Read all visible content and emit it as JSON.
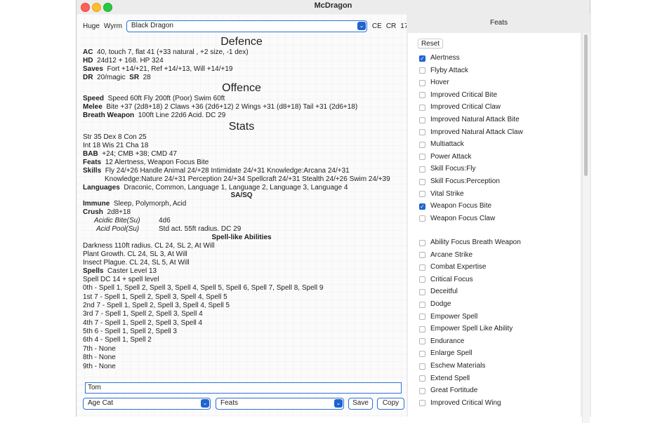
{
  "window": {
    "title": "McDragon"
  },
  "header": {
    "size": "Huge",
    "age": "Wyrm",
    "creature": "Black Dragon",
    "alignment": "CE",
    "cr_label": "CR",
    "cr_value": "17"
  },
  "defence": {
    "heading": "Defence",
    "ac_label": "AC",
    "ac": "40, touch 7, flat 41 (+33 natural , +2 size, -1 dex)",
    "hd_label": "HD",
    "hd": "24d12 + 168. HP 324",
    "saves_label": "Saves",
    "saves": "Fort +14/+21, Ref +14/+13, Will +14/+19",
    "dr_label": "DR",
    "dr": "20/magic",
    "sr_label": "SR",
    "sr": "28"
  },
  "offence": {
    "heading": "Offence",
    "speed_label": "Speed",
    "speed": "Speed 60ft Fly 200ft (Poor) Swim 60ft",
    "melee_label": "Melee",
    "melee": "Bite +37 (2d8+18) 2 Claws +36 (2d6+12) 2 Wings +31 (d8+18) Tail +31 (2d6+18)",
    "breath_label": "Breath Weapon",
    "breath": "100ft Line 22d6 Acid. DC 29"
  },
  "stats": {
    "heading": "Stats",
    "line1": "Str  35  Dex  8  Con  25",
    "line2": "Int  18  Wis  21  Cha  18",
    "bab_label": "BAB",
    "bab": "+24; CMB +38; CMD 47",
    "feats_label": "Feats",
    "feats": "12  Alertness, Weapon Focus Bite",
    "skills_label": "Skills",
    "skills1": "Fly 24/+26 Handle Animal 24/+28 Intimidate 24/+31 Knowledge:Arcana 24/+31",
    "skills2": "Knowledge:Nature 24/+31 Perception 24/+34 Spellcraft 24/+31 Stealth 24/+26 Swim 24/+39",
    "languages_label": "Languages",
    "languages": "Draconic, Common, Language 1, Language 2, Language 3, Language 4"
  },
  "sasq": {
    "heading": "SA/SQ",
    "immune_label": "Immune",
    "immune": "Sleep, Polymorph, Acid",
    "crush_label": "Crush",
    "crush": "2d8+18",
    "acidic_bite_label": "Acidic Bite(Su)",
    "acidic_bite": "4d6",
    "acid_pool_label": "Acid Pool(Su)",
    "acid_pool": "Std act. 55ft radius. DC 29"
  },
  "spell_like": {
    "heading": "Spell-like Abilities",
    "items": [
      "Darkness 110ft radius. CL 24, SL 2, At Will",
      "Plant Growth. CL 24, SL 3, At Will",
      "Insect Plague. CL 24, SL 5, At Will"
    ],
    "spells_label": "Spells",
    "spells": "Caster Level 13",
    "dc": "Spell DC 14 + spell level",
    "levels": [
      "0th - Spell 1, Spell 2, Spell 3, Spell 4, Spell 5, Spell 6, Spell 7, Spell 8, Spell 9",
      "1st 7 - Spell 1, Spell 2, Spell 3, Spell 4, Spell 5",
      "2nd 7 - Spell 1, Spell 2, Spell 3, Spell 4, Spell 5",
      "3rd 7 - Spell 1, Spell 2, Spell 3, Spell 4",
      "4th 7 - Spell 1, Spell 2, Spell 3, Spell 4",
      "5th 6 - Spell 1, Spell 2, Spell 3",
      "6th 4 - Spell 1, Spell 2",
      "7th - None",
      "8th - None",
      "9th - None"
    ]
  },
  "footer": {
    "name_value": "Tom",
    "age_select": "Age Cat",
    "view_select": "Feats",
    "save_label": "Save",
    "copy_label": "Copy"
  },
  "feats_panel": {
    "title": "Feats",
    "reset_label": "Reset",
    "group1": [
      {
        "label": "Alertness",
        "checked": true
      },
      {
        "label": "Flyby Attack",
        "checked": false
      },
      {
        "label": "Hover",
        "checked": false
      },
      {
        "label": "Improved Critical Bite",
        "checked": false
      },
      {
        "label": "Improved Critical Claw",
        "checked": false
      },
      {
        "label": "Improved Natural Attack Bite",
        "checked": false
      },
      {
        "label": "Improved Natural Attack Claw",
        "checked": false
      },
      {
        "label": "Multiattack",
        "checked": false
      },
      {
        "label": "Power Attack",
        "checked": false
      },
      {
        "label": "Skill Focus:Fly",
        "checked": false
      },
      {
        "label": "Skill Focus:Perception",
        "checked": false
      },
      {
        "label": "Vital Strike",
        "checked": false
      },
      {
        "label": "Weapon Focus Bite",
        "checked": true
      },
      {
        "label": "Weapon Focus Claw",
        "checked": false
      }
    ],
    "group2": [
      {
        "label": "Ability Focus Breath Weapon",
        "checked": false
      },
      {
        "label": "Arcane Strike",
        "checked": false
      },
      {
        "label": "Combat Expertise",
        "checked": false
      },
      {
        "label": "Critical Focus",
        "checked": false
      },
      {
        "label": "Deceitful",
        "checked": false
      },
      {
        "label": "Dodge",
        "checked": false
      },
      {
        "label": "Empower Spell",
        "checked": false
      },
      {
        "label": "Empower Spell Like Ability",
        "checked": false
      },
      {
        "label": "Endurance",
        "checked": false
      },
      {
        "label": "Enlarge Spell",
        "checked": false
      },
      {
        "label": "Eschew Materials",
        "checked": false
      },
      {
        "label": "Extend Spell",
        "checked": false
      },
      {
        "label": "Great Fortitude",
        "checked": false
      },
      {
        "label": "Improved Critical Wing",
        "checked": false
      }
    ]
  }
}
